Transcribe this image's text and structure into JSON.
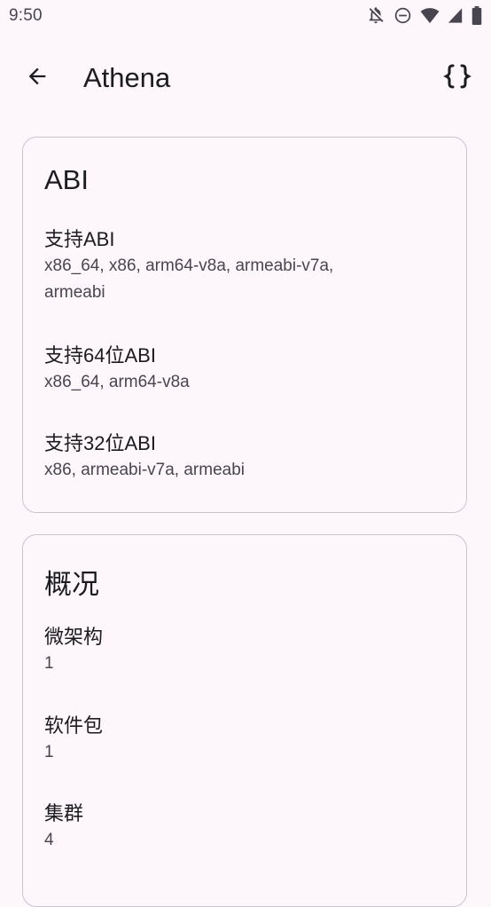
{
  "status_bar": {
    "time": "9:50",
    "icons": [
      "notifications-off-icon",
      "do-not-disturb-icon",
      "wifi-icon",
      "cellular-icon",
      "battery-icon"
    ]
  },
  "app_bar": {
    "title": "Athena",
    "back_icon": "arrow-back-icon",
    "action_icon": "code-braces-icon"
  },
  "abi_card": {
    "title": "ABI",
    "items": [
      {
        "label": "支持ABI",
        "value": "x86_64, x86, arm64-v8a, armeabi-v7a,",
        "value_line2": "armeabi"
      },
      {
        "label": "支持64位ABI",
        "value": "x86_64, arm64-v8a"
      },
      {
        "label": "支持32位ABI",
        "value": "x86, armeabi-v7a, armeabi"
      }
    ]
  },
  "overview_card": {
    "title": "概况",
    "items": [
      {
        "label": "微架构",
        "value": "1"
      },
      {
        "label": "软件包",
        "value": "1"
      },
      {
        "label": "集群",
        "value": "4"
      }
    ]
  }
}
